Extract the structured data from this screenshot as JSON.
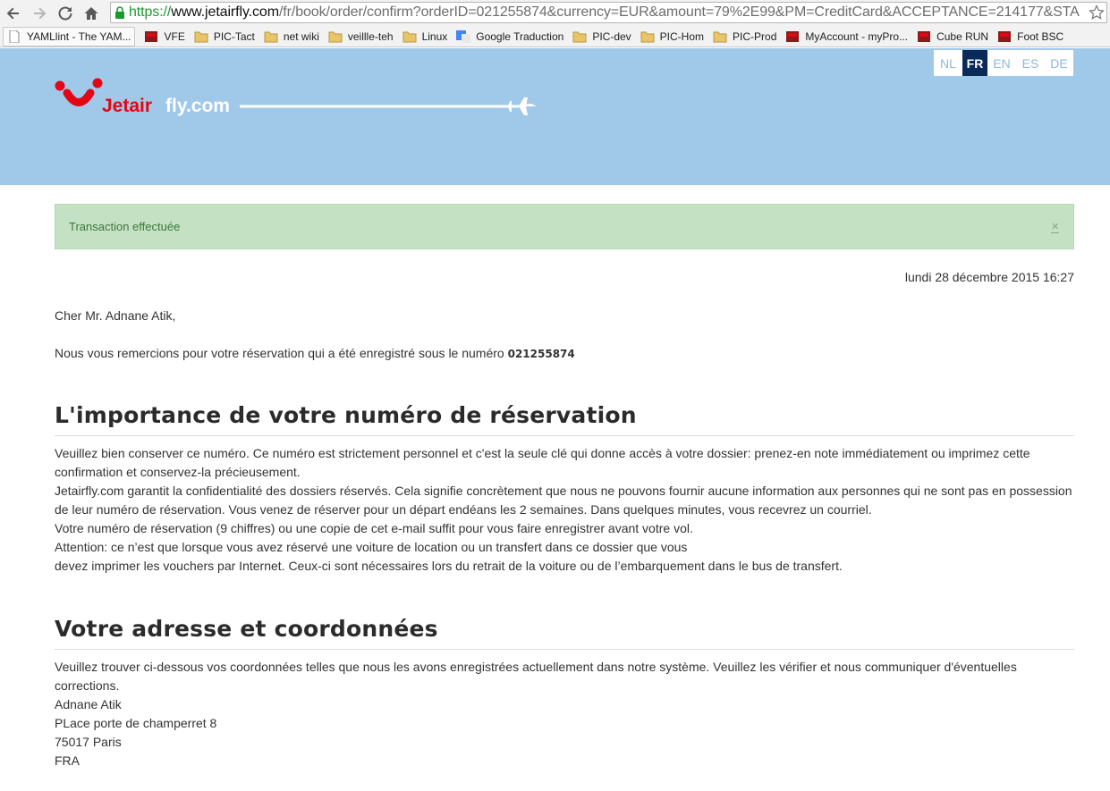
{
  "browser": {
    "url_scheme": "https://",
    "url_host": "www.jetairfly.com",
    "url_path": "/fr/book/order/confirm?orderID=021255874&currency=EUR&amount=79%2E99&PM=CreditCard&ACCEPTANCE=214177&STA"
  },
  "bookmarks": [
    {
      "label": "YAMLlint - The YAM...",
      "icon": "page-icon"
    },
    {
      "label": "VFE",
      "icon": "site-icon"
    },
    {
      "label": "PIC-Tact",
      "icon": "folder-icon"
    },
    {
      "label": "net wiki",
      "icon": "folder-icon"
    },
    {
      "label": "veillle-teh",
      "icon": "folder-icon"
    },
    {
      "label": "Linux",
      "icon": "folder-icon"
    },
    {
      "label": "Google Traduction",
      "icon": "translate-icon"
    },
    {
      "label": "PIC-dev",
      "icon": "folder-icon"
    },
    {
      "label": "PIC-Hom",
      "icon": "folder-icon"
    },
    {
      "label": "PIC-Prod",
      "icon": "folder-icon"
    },
    {
      "label": "MyAccount - myPro...",
      "icon": "site-icon"
    },
    {
      "label": "Cube RUN",
      "icon": "site-icon"
    },
    {
      "label": "Foot BSC",
      "icon": "site-icon"
    }
  ],
  "header": {
    "logo_text_bold": "Jetair",
    "logo_text_light": "fly.com",
    "languages": [
      "NL",
      "FR",
      "EN",
      "ES",
      "DE"
    ],
    "active_language": "FR"
  },
  "alert": {
    "message": "Transaction effectuée",
    "close": "×"
  },
  "content": {
    "date": "lundi 28 décembre 2015 16:27",
    "greeting": "Cher Mr. Adnane Atik,",
    "thanks_text": "Nous vous remercions pour votre réservation qui a été enregistré sous le numéro ",
    "order_number": "021255874",
    "section1_title": "L'importance de votre numéro de réservation",
    "section1_lines": [
      "Veuillez bien conserver ce numéro. Ce numéro est strictement personnel et c'est la seule clé qui donne accès à votre dossier: prenez-en note immédiatement ou imprimez cette confirmation et conservez-la précieusement.",
      "Jetairfly.com garantit la confidentialité des dossiers réservés. Cela signifie concrètement que nous ne pouvons fournir aucune information aux personnes qui ne sont pas en possession de leur numéro de réservation. Vous venez de réserver pour un départ endéans les 2 semaines. Dans quelques minutes, vous recevrez un courriel.",
      "Votre numéro de réservation (9 chiffres) ou une copie de cet e-mail suffit pour vous faire enregistrer avant votre vol.",
      "Attention: ce n’est que lorsque vous avez réservé une voiture de location ou un transfert dans ce dossier que vous",
      "devez imprimer les vouchers par Internet. Ceux-ci sont nécessaires lors du retrait de la voiture ou de l’embarquement dans le bus de transfert."
    ],
    "section2_title": "Votre adresse et coordonnées",
    "section2_intro": "Veuillez trouver ci-dessous vos coordonnées telles que nous les avons enregistrées actuellement dans notre système. Veuillez les vérifier et nous communiquer d'éventuelles corrections.",
    "address": [
      "Adnane Atik",
      "PLace porte de champerret 8",
      "75017 Paris",
      "FRA"
    ]
  },
  "colors": {
    "header_bg": "#a0c8e9",
    "brand_red": "#e30613",
    "alert_bg": "#c5e1c3",
    "lang_active": "#0a2a5a"
  }
}
